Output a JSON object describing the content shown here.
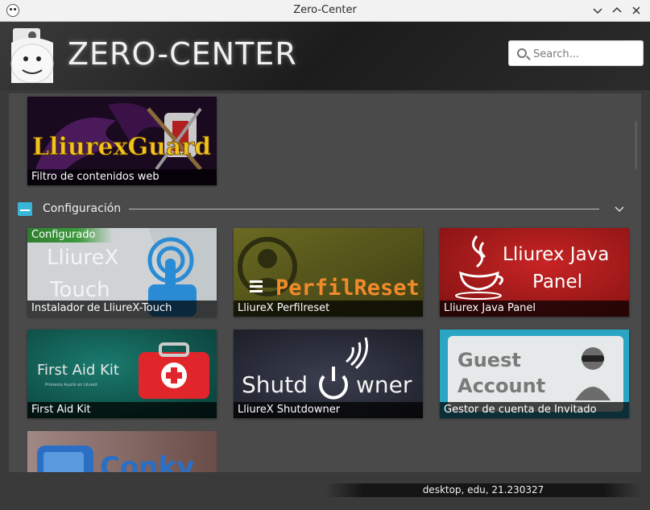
{
  "window": {
    "title": "Zero-Center"
  },
  "header": {
    "logo_text": "ZERO-CENTER",
    "search_placeholder": "Search..."
  },
  "tiles_top": [
    {
      "art_text": "LliurexGuard",
      "caption": "Filtro de contenidos web"
    }
  ],
  "section": {
    "title": "Configuración"
  },
  "tiles": [
    {
      "caption": "Instalador de LliureX-Touch",
      "badge": "Configurado",
      "art_line1": "LliureX",
      "art_line2": "Touch"
    },
    {
      "caption": "LliureX Perfilreset",
      "art_text": "PerfilReset"
    },
    {
      "caption": "Lliurex Java Panel",
      "art_line1": "Lliurex Java",
      "art_line2": "Panel"
    },
    {
      "caption": "First Aid Kit",
      "art_line1": "First Aid Kit",
      "art_line2": "Primeros Auxils en LliureX"
    },
    {
      "caption": "LliureX Shutdowner",
      "art_left": "Shutd",
      "art_right": "wner"
    },
    {
      "caption": "Gestor de cuenta de Invitado",
      "art_line1": "Guest",
      "art_line2": "Account"
    },
    {
      "art_text": "Conky"
    }
  ],
  "status_text": "desktop, edu, 21.230327",
  "colors": {
    "accent": "#39b5d8",
    "badge_green": "#3d9a3d",
    "java_red": "#b01d1d"
  }
}
